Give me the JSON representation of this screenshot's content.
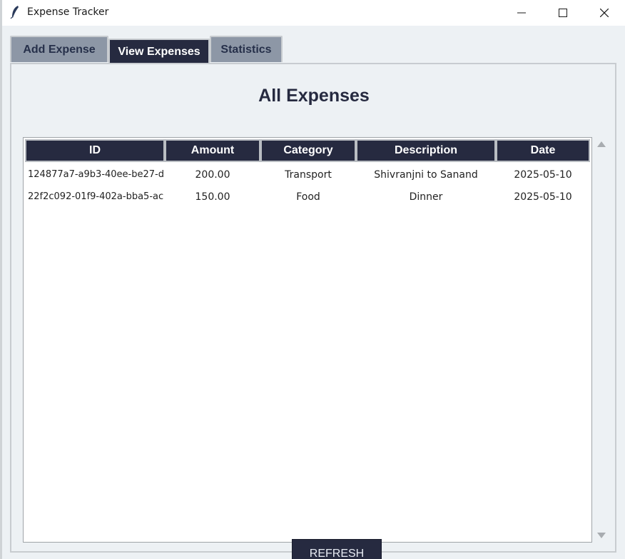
{
  "window": {
    "title": "Expense Tracker",
    "controls": {
      "minimize": "minimize-icon",
      "maximize": "maximize-icon",
      "close": "close-icon"
    }
  },
  "tabs": [
    {
      "label": "Add Expense",
      "active": false
    },
    {
      "label": "View Expenses",
      "active": true
    },
    {
      "label": "Statistics",
      "active": false
    }
  ],
  "page": {
    "heading": "All Expenses"
  },
  "table": {
    "columns": [
      "ID",
      "Amount",
      "Category",
      "Description",
      "Date"
    ],
    "rows": [
      [
        "124877a7-a9b3-40ee-be27-d",
        "200.00",
        "Transport",
        "Shivranjni to Sanand",
        "2025-05-10"
      ],
      [
        "22f2c092-01f9-402a-bba5-ac",
        "150.00",
        "Food",
        "Dinner",
        "2025-05-10"
      ]
    ]
  },
  "buttons": {
    "refresh": "REFRESH"
  },
  "colors": {
    "accent": "#262a40",
    "tab_inactive": "#8d97a6",
    "background": "#edf1f4"
  }
}
